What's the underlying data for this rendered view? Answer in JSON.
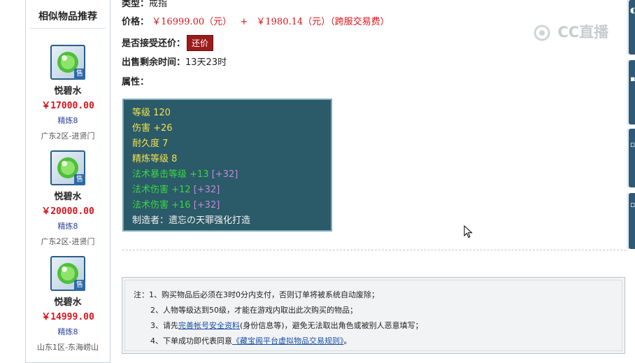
{
  "sidebar": {
    "title": "相似物品推荐",
    "items": [
      {
        "name": "悦碧水",
        "price": "￥17000.00",
        "refine": "精炼8",
        "server": "广东2区-进贤门",
        "badge": "售"
      },
      {
        "name": "悦碧水",
        "price": "￥20000.00",
        "refine": "精炼8",
        "server": "广东2区-进贤门",
        "badge": "售"
      },
      {
        "name": "悦碧水",
        "price": "￥14999.00",
        "refine": "精炼8",
        "server": "山东1区-东海崂山",
        "badge": "售"
      }
    ]
  },
  "detail": {
    "type_label": "类型：",
    "type_value": "戒指",
    "price_label": "价格：",
    "price_main": "￥16999.00（元）",
    "price_plus": "+",
    "price_fee": "￥1980.14（元）（跨服交易费）",
    "bargain_label": "是否接受还价：",
    "bargain_button": "还价",
    "time_label": "出售剩余时间：",
    "time_value": "13天23时",
    "attr_label": "属性："
  },
  "attributes": {
    "lines": [
      {
        "text": "等级 120"
      },
      {
        "text": "伤害 +26"
      },
      {
        "text": "耐久度 7"
      },
      {
        "text": "精炼等级 8"
      }
    ],
    "bonus": [
      {
        "text": "法术暴击等级 +13",
        "extra": "[+32]"
      },
      {
        "text": "法术伤害 +12",
        "extra": "[+32]"
      },
      {
        "text": "法术伤害 +16",
        "extra": "[+32]"
      }
    ],
    "maker": "制造者：遗忘の天罪强化打造"
  },
  "notes": {
    "line1": "注：1、购买物品后必须在3时0分内支付，否则订单将被系统自动废除；",
    "line2": "2、人物等级达到50级，才能在游戏内取出此次购买的物品；",
    "line3_pre": "3、请先",
    "line3_link": "完善帐号安全资料",
    "line3_post": "(身份信息等)，避免无法取出角色或被别人恶意填写；",
    "line4_pre": "4、下单成功即代表同意",
    "line4_link": "《藏宝阁平台虚拟物品交易规则》",
    "line4_post": "。"
  },
  "watermark": "CC直播",
  "colors": {
    "accent_red": "#d8141c",
    "attr_bg": "#2b5a69",
    "yellow": "#f2e44a",
    "green": "#3bd640",
    "purple": "#c08bd6"
  }
}
